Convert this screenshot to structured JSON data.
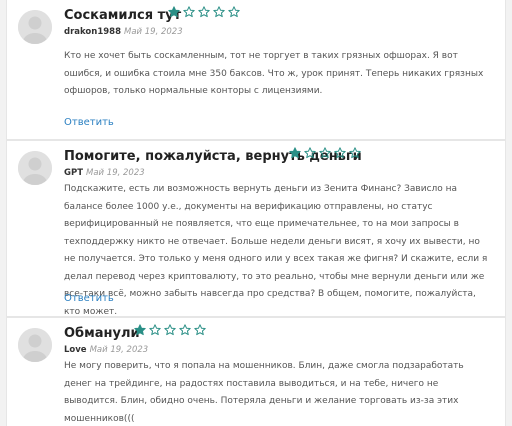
{
  "reply_label": "Ответить",
  "colors": {
    "star": "#2a8f86",
    "link": "#2a7fc1",
    "avatar": "#cfcfcf"
  },
  "reviews": [
    {
      "title": "Соскамился тут",
      "rating": 1,
      "max_rating": 5,
      "author": "drakon1988",
      "date": "Май 19, 2023",
      "text": "Кто не хочет быть соскамленным, тот не торгует в таких грязных офшорах. Я вот ошибся, и ошибка стоила мне 350 баксов. Что ж, урок принят. Теперь никаких грязных офшоров, только нормальные конторы с лицензиями."
    },
    {
      "title": "Помогите, пожалуйста, вернуть деньги",
      "rating": 1,
      "max_rating": 5,
      "author": "GPT",
      "date": "Май 19, 2023",
      "text": "Подскажите, есть ли возможность вернуть деньги из Зенита Финанс? Зависло на балансе более 1000 у.е., документы на верификацию отправлены, но статус верифицированный не появляется, что еще примечательнее, то на мои запросы в техподдержку никто не отвечает. Больше недели деньги висят, я хочу их вывести, но не получается. Это только у меня одного или у всех такая же фигня? И скажите, если я делал перевод через криптовалюту, то это реально, чтобы мне вернули деньги или же все-таки всё, можно забыть навсегда про средства? В общем, помогите, пожалуйста, кто может."
    },
    {
      "title": "Обманули",
      "rating": 1,
      "max_rating": 5,
      "author": "Love",
      "date": "Май 19, 2023",
      "text": "Не могу поверить, что я попала на мошенников. Блин, даже смогла подзаработать денег на трейдинге, на радостях поставила выводиться, и на тебе, ничего не выводится. Блин, обидно очень. Потеряла деньги и желание торговать из-за этих мошенников((("
    }
  ]
}
